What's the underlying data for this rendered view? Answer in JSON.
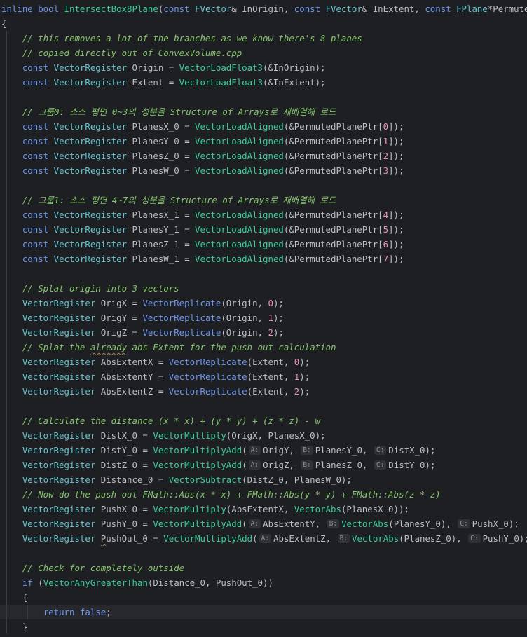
{
  "editor": {
    "lines": [
      {
        "indent": 0,
        "tokens": [
          [
            "kw",
            "inline bool "
          ],
          [
            "fn2",
            "IntersectBox8Plane"
          ],
          [
            "tx",
            "("
          ],
          [
            "kw",
            "const "
          ],
          [
            "ty",
            "FVector"
          ],
          [
            "tx",
            "& InOrigin, "
          ],
          [
            "kw",
            "const "
          ],
          [
            "ty",
            "FVector"
          ],
          [
            "tx",
            "& InExtent, "
          ],
          [
            "kw",
            "const "
          ],
          [
            "ty",
            "FPlane"
          ],
          [
            "tx",
            "*PermutedPlanePtr)"
          ]
        ]
      },
      {
        "indent": 0,
        "tokens": [
          [
            "tx",
            "{"
          ]
        ]
      },
      {
        "indent": 1,
        "tokens": [
          [
            "cm",
            "// this removes a lot of the branches as we know there's 8 planes"
          ]
        ]
      },
      {
        "indent": 1,
        "tokens": [
          [
            "cm",
            "// copied directly out of ConvexVolume.cpp"
          ]
        ]
      },
      {
        "indent": 1,
        "tokens": [
          [
            "kw",
            "const "
          ],
          [
            "ty",
            "VectorRegister "
          ],
          [
            "tx",
            "Origin = "
          ],
          [
            "fn",
            "VectorLoadFloat3"
          ],
          [
            "tx",
            "(&InOrigin);"
          ]
        ]
      },
      {
        "indent": 1,
        "tokens": [
          [
            "kw",
            "const "
          ],
          [
            "ty",
            "VectorRegister "
          ],
          [
            "tx",
            "Extent = "
          ],
          [
            "fn",
            "VectorLoadFloat3"
          ],
          [
            "tx",
            "(&InExtent);"
          ]
        ]
      },
      {
        "indent": 1,
        "tokens": []
      },
      {
        "indent": 1,
        "tokens": [
          [
            "cm",
            "// 그룹0: 소스 평면 0~3의 성분을 Structure of Arrays로 재배열해 로드"
          ]
        ]
      },
      {
        "indent": 1,
        "tokens": [
          [
            "kw",
            "const "
          ],
          [
            "ty",
            "VectorRegister "
          ],
          [
            "tx",
            "PlanesX_0 = "
          ],
          [
            "fn",
            "VectorLoadAligned"
          ],
          [
            "tx",
            "(&PermutedPlanePtr["
          ],
          [
            "num",
            "0"
          ],
          [
            "tx",
            "]);"
          ]
        ]
      },
      {
        "indent": 1,
        "tokens": [
          [
            "kw",
            "const "
          ],
          [
            "ty",
            "VectorRegister "
          ],
          [
            "tx",
            "PlanesY_0 = "
          ],
          [
            "fn",
            "VectorLoadAligned"
          ],
          [
            "tx",
            "(&PermutedPlanePtr["
          ],
          [
            "num",
            "1"
          ],
          [
            "tx",
            "]);"
          ]
        ]
      },
      {
        "indent": 1,
        "tokens": [
          [
            "kw",
            "const "
          ],
          [
            "ty",
            "VectorRegister "
          ],
          [
            "tx",
            "PlanesZ_0 = "
          ],
          [
            "fn",
            "VectorLoadAligned"
          ],
          [
            "tx",
            "(&PermutedPlanePtr["
          ],
          [
            "num",
            "2"
          ],
          [
            "tx",
            "]);"
          ]
        ]
      },
      {
        "indent": 1,
        "tokens": [
          [
            "kw",
            "const "
          ],
          [
            "ty",
            "VectorRegister "
          ],
          [
            "tx",
            "PlanesW_0 = "
          ],
          [
            "fn",
            "VectorLoadAligned"
          ],
          [
            "tx",
            "(&PermutedPlanePtr["
          ],
          [
            "num",
            "3"
          ],
          [
            "tx",
            "]);"
          ]
        ]
      },
      {
        "indent": 1,
        "tokens": []
      },
      {
        "indent": 1,
        "tokens": [
          [
            "cm",
            "// 그룹1: 소스 평면 4~7의 성분을 Structure of Arrays로 재배열해 로드"
          ]
        ]
      },
      {
        "indent": 1,
        "tokens": [
          [
            "kw",
            "const "
          ],
          [
            "ty",
            "VectorRegister "
          ],
          [
            "tx",
            "PlanesX_1 = "
          ],
          [
            "fn",
            "VectorLoadAligned"
          ],
          [
            "tx",
            "(&PermutedPlanePtr["
          ],
          [
            "num",
            "4"
          ],
          [
            "tx",
            "]);"
          ]
        ]
      },
      {
        "indent": 1,
        "tokens": [
          [
            "kw",
            "const "
          ],
          [
            "ty",
            "VectorRegister "
          ],
          [
            "tx",
            "PlanesY_1 = "
          ],
          [
            "fn",
            "VectorLoadAligned"
          ],
          [
            "tx",
            "(&PermutedPlanePtr["
          ],
          [
            "num",
            "5"
          ],
          [
            "tx",
            "]);"
          ]
        ]
      },
      {
        "indent": 1,
        "tokens": [
          [
            "kw",
            "const "
          ],
          [
            "ty",
            "VectorRegister "
          ],
          [
            "tx",
            "PlanesZ_1 = "
          ],
          [
            "fn",
            "VectorLoadAligned"
          ],
          [
            "tx",
            "(&PermutedPlanePtr["
          ],
          [
            "num",
            "6"
          ],
          [
            "tx",
            "]);"
          ]
        ]
      },
      {
        "indent": 1,
        "tokens": [
          [
            "kw",
            "const "
          ],
          [
            "ty",
            "VectorRegister "
          ],
          [
            "tx",
            "PlanesW_1 = "
          ],
          [
            "fn",
            "VectorLoadAligned"
          ],
          [
            "tx",
            "(&PermutedPlanePtr["
          ],
          [
            "num",
            "7"
          ],
          [
            "tx",
            "]);"
          ]
        ]
      },
      {
        "indent": 1,
        "tokens": []
      },
      {
        "indent": 1,
        "tokens": [
          [
            "cm",
            "// Splat origin into 3 vectors"
          ]
        ]
      },
      {
        "indent": 1,
        "tokens": [
          [
            "ty",
            "VectorRegister "
          ],
          [
            "tx",
            "OrigX = "
          ],
          [
            "fnb",
            "VectorReplicate"
          ],
          [
            "tx",
            "(Origin, "
          ],
          [
            "num",
            "0"
          ],
          [
            "tx",
            ");"
          ]
        ]
      },
      {
        "indent": 1,
        "tokens": [
          [
            "ty",
            "VectorRegister "
          ],
          [
            "tx",
            "OrigY = "
          ],
          [
            "fnb",
            "VectorReplicate"
          ],
          [
            "tx",
            "(Origin, "
          ],
          [
            "num",
            "1"
          ],
          [
            "tx",
            ");"
          ]
        ]
      },
      {
        "indent": 1,
        "tokens": [
          [
            "ty",
            "VectorRegister "
          ],
          [
            "tx",
            "OrigZ = "
          ],
          [
            "fnb",
            "VectorReplicate"
          ],
          [
            "tx",
            "(Origin, "
          ],
          [
            "num",
            "2"
          ],
          [
            "tx",
            ");"
          ]
        ]
      },
      {
        "indent": 1,
        "tokens": [
          [
            "cm",
            "// Splat the "
          ],
          [
            "cmsq",
            "already"
          ],
          [
            "cm",
            " abs Extent for the push out calculation"
          ]
        ]
      },
      {
        "indent": 1,
        "tokens": [
          [
            "ty",
            "VectorRegister "
          ],
          [
            "tx",
            "AbsExtentX = "
          ],
          [
            "fnb",
            "VectorReplicate"
          ],
          [
            "tx",
            "(Extent, "
          ],
          [
            "num",
            "0"
          ],
          [
            "tx",
            ");"
          ]
        ]
      },
      {
        "indent": 1,
        "tokens": [
          [
            "ty",
            "VectorRegister "
          ],
          [
            "tx",
            "AbsExtentY = "
          ],
          [
            "fnb",
            "VectorReplicate"
          ],
          [
            "tx",
            "(Extent, "
          ],
          [
            "num",
            "1"
          ],
          [
            "tx",
            ");"
          ]
        ]
      },
      {
        "indent": 1,
        "tokens": [
          [
            "ty",
            "VectorRegister "
          ],
          [
            "tx",
            "AbsExtentZ = "
          ],
          [
            "fnb",
            "VectorReplicate"
          ],
          [
            "tx",
            "(Extent, "
          ],
          [
            "num",
            "2"
          ],
          [
            "tx",
            ");"
          ]
        ]
      },
      {
        "indent": 1,
        "tokens": []
      },
      {
        "indent": 1,
        "tokens": [
          [
            "cm",
            "// Calculate the distance (x * x) + (y * y) + (z * z) - w"
          ]
        ]
      },
      {
        "indent": 1,
        "tokens": [
          [
            "ty",
            "VectorRegister "
          ],
          [
            "tx",
            "DistX_0 = "
          ],
          [
            "fn",
            "VectorMultiply"
          ],
          [
            "tx",
            "(OrigX, PlanesX_0);"
          ]
        ]
      },
      {
        "indent": 1,
        "tokens": [
          [
            "ty",
            "VectorRegister "
          ],
          [
            "tx",
            "DistY_0 = "
          ],
          [
            "fn",
            "VectorMultiplyAdd"
          ],
          [
            "tx",
            "("
          ],
          [
            "hint",
            "A:"
          ],
          [
            "tx",
            "OrigY, "
          ],
          [
            "hint",
            "B:"
          ],
          [
            "tx",
            "PlanesY_0, "
          ],
          [
            "hint",
            "C:"
          ],
          [
            "tx",
            "DistX_0);"
          ]
        ]
      },
      {
        "indent": 1,
        "tokens": [
          [
            "ty",
            "VectorRegister "
          ],
          [
            "tx",
            "DistZ_0 = "
          ],
          [
            "fn",
            "VectorMultiplyAdd"
          ],
          [
            "tx",
            "("
          ],
          [
            "hint",
            "A:"
          ],
          [
            "tx",
            "OrigZ, "
          ],
          [
            "hint",
            "B:"
          ],
          [
            "tx",
            "PlanesZ_0, "
          ],
          [
            "hint",
            "C:"
          ],
          [
            "tx",
            "DistY_0);"
          ]
        ]
      },
      {
        "indent": 1,
        "tokens": [
          [
            "ty",
            "VectorRegister "
          ],
          [
            "tx",
            "Distance_0 = "
          ],
          [
            "fn",
            "VectorSubtract"
          ],
          [
            "tx",
            "(DistZ_0, PlanesW_0);"
          ]
        ]
      },
      {
        "indent": 1,
        "tokens": [
          [
            "cm",
            "// Now do the push out FMath::Abs(x * x) + FMath::Abs(y * y) + FMath::Abs(z * z)"
          ]
        ]
      },
      {
        "indent": 1,
        "tokens": [
          [
            "ty",
            "VectorRegister "
          ],
          [
            "tx",
            "PushX_0 = "
          ],
          [
            "fn",
            "VectorMultiply"
          ],
          [
            "tx",
            "(AbsExtentX, "
          ],
          [
            "fn",
            "VectorAbs"
          ],
          [
            "tx",
            "(PlanesX_0));"
          ]
        ]
      },
      {
        "indent": 1,
        "tokens": [
          [
            "ty",
            "VectorRegister "
          ],
          [
            "tx",
            "PushY_0 = "
          ],
          [
            "fn",
            "VectorMultiplyAdd"
          ],
          [
            "tx",
            "("
          ],
          [
            "hint",
            "A:"
          ],
          [
            "tx",
            "AbsExtentY, "
          ],
          [
            "hint",
            "B:"
          ],
          [
            "fn",
            "VectorAbs"
          ],
          [
            "tx",
            "(PlanesY_0), "
          ],
          [
            "hint",
            "C:"
          ],
          [
            "tx",
            "PushX_0);"
          ]
        ]
      },
      {
        "indent": 1,
        "tokens": [
          [
            "ty",
            "VectorRegister "
          ],
          [
            "txsq",
            "P"
          ],
          [
            "tx",
            "ushOut_0 = "
          ],
          [
            "fn",
            "VectorMultiplyAdd"
          ],
          [
            "tx",
            "("
          ],
          [
            "hint",
            "A:"
          ],
          [
            "tx",
            "AbsExtentZ, "
          ],
          [
            "hint",
            "B:"
          ],
          [
            "fn",
            "VectorAbs"
          ],
          [
            "tx",
            "(PlanesZ_0), "
          ],
          [
            "hint",
            "C:"
          ],
          [
            "tx",
            "PushY_0);"
          ]
        ]
      },
      {
        "indent": 1,
        "tokens": []
      },
      {
        "indent": 1,
        "tokens": [
          [
            "cm",
            "// Check for completely outside"
          ]
        ]
      },
      {
        "indent": 1,
        "tokens": [
          [
            "kw",
            "if "
          ],
          [
            "tx",
            "("
          ],
          [
            "fn",
            "VectorAnyGreaterThan"
          ],
          [
            "tx",
            "(Distance_0, PushOut_0))"
          ]
        ]
      },
      {
        "indent": 1,
        "tokens": [
          [
            "tx",
            "{"
          ]
        ]
      },
      {
        "indent": 2,
        "current": true,
        "tokens": [
          [
            "kw",
            "return false"
          ],
          [
            "tx",
            ";"
          ]
        ]
      },
      {
        "indent": 1,
        "tokens": [
          [
            "tx",
            "}"
          ]
        ]
      }
    ]
  }
}
